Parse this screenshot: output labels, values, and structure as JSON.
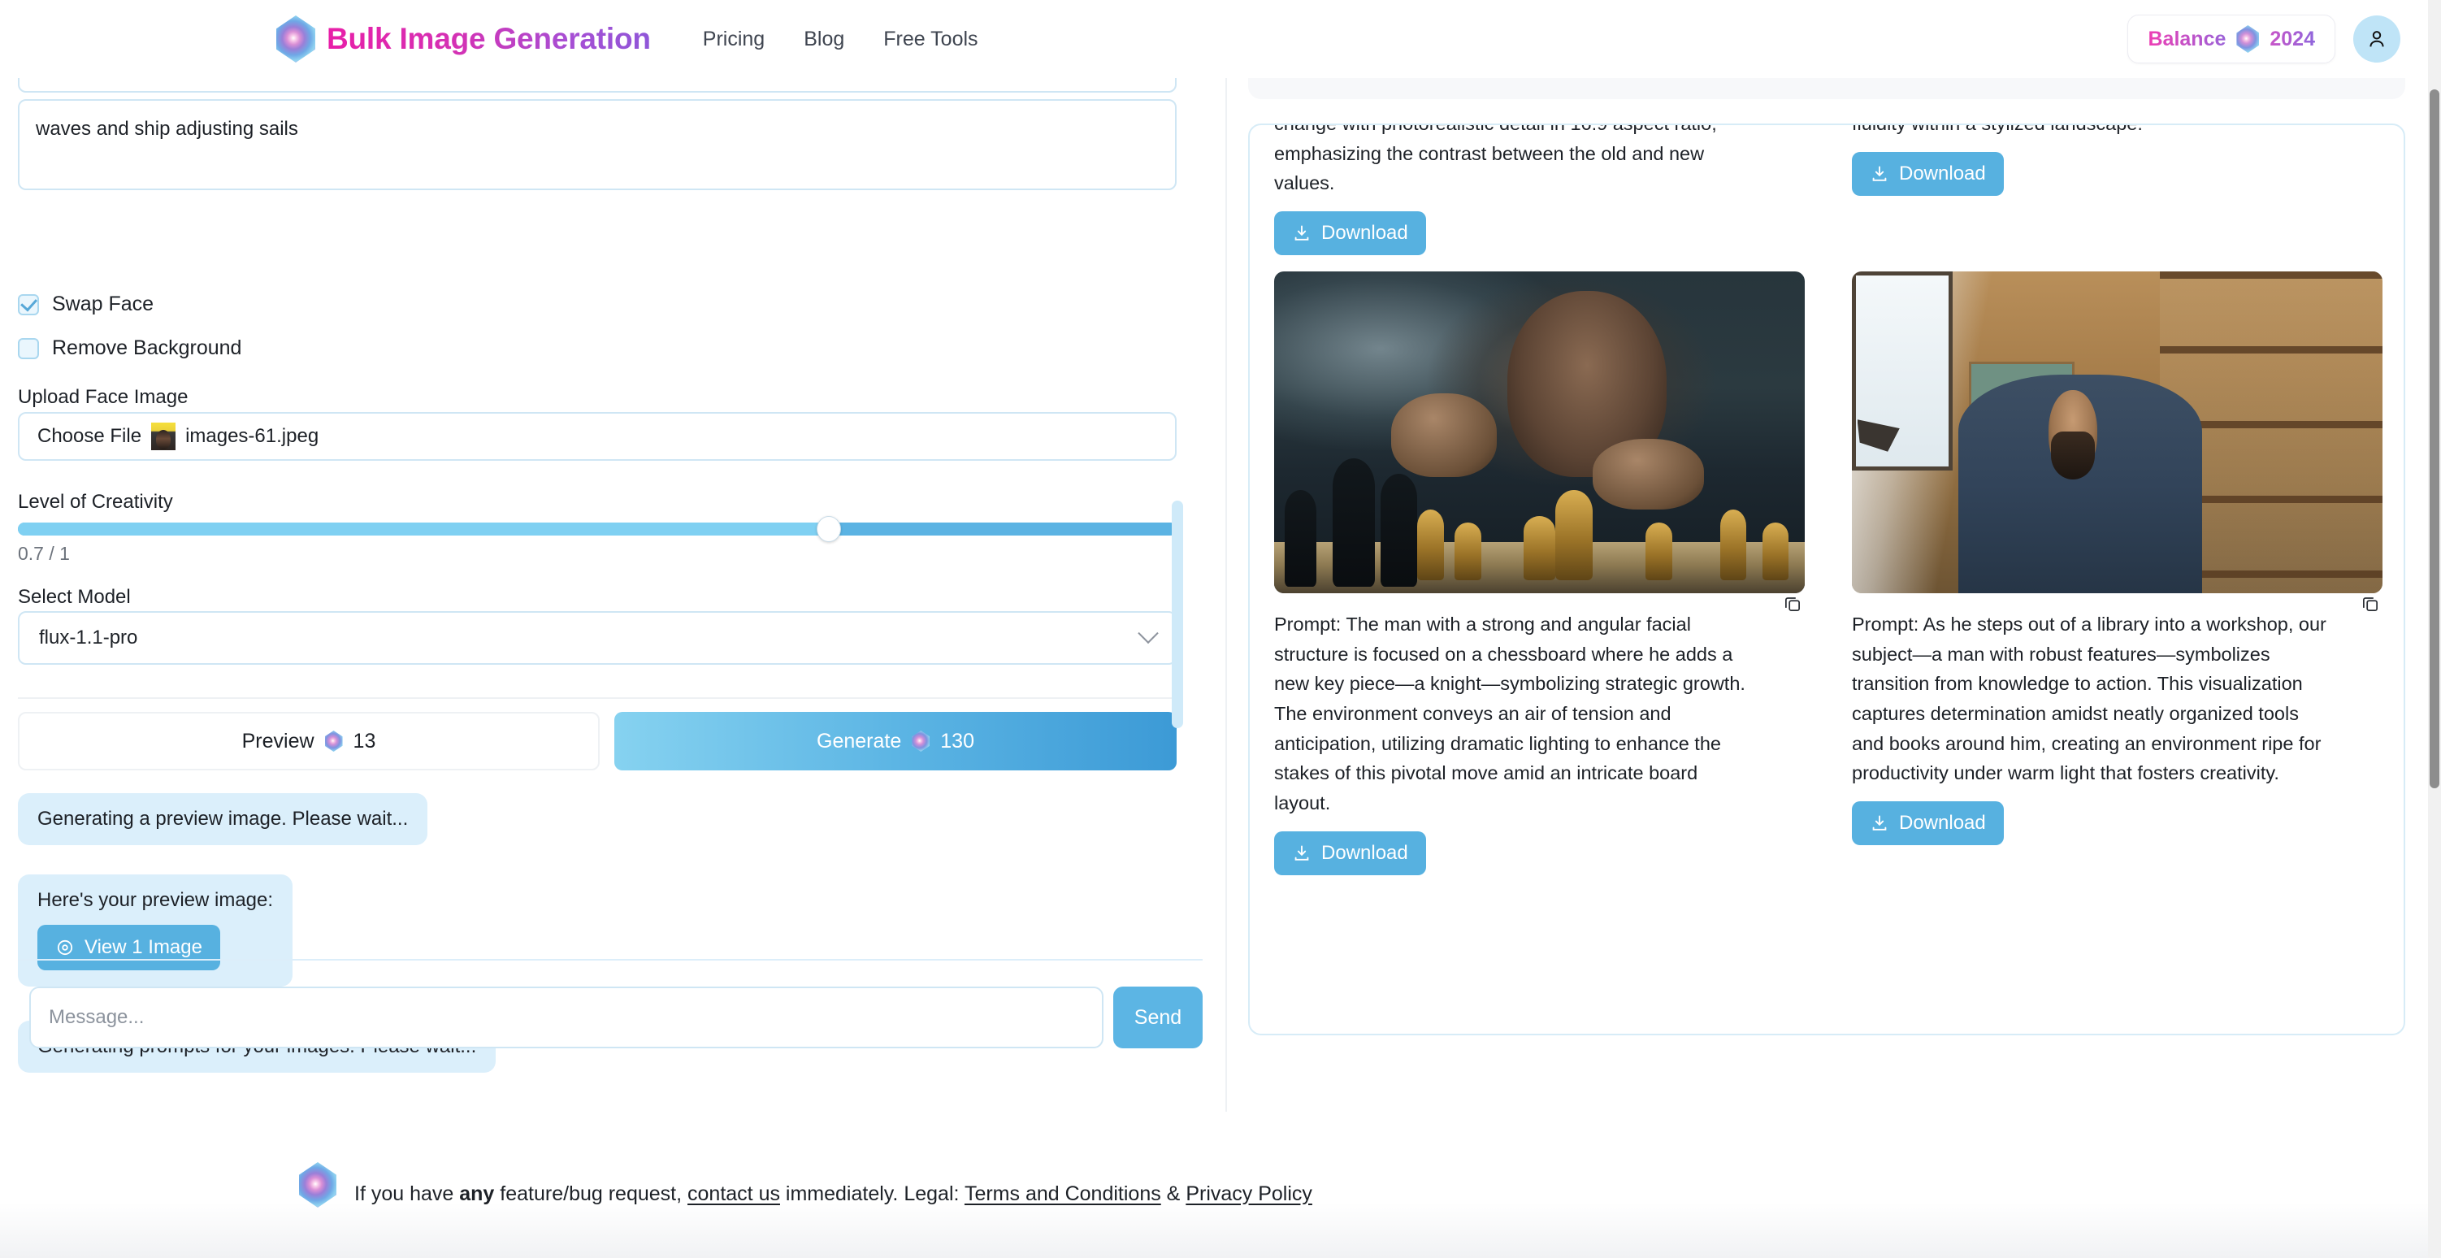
{
  "header": {
    "brand_title": "Bulk Image Generation",
    "logo_icon": "gem-logo-icon",
    "nav": [
      {
        "label": "Pricing"
      },
      {
        "label": "Blog"
      },
      {
        "label": "Free Tools"
      }
    ],
    "balance": {
      "label": "Balance",
      "amount": "2024",
      "coin_icon": "gem-coin-icon"
    },
    "account_icon": "user-avatar-icon"
  },
  "left_panel": {
    "prompt_textarea": {
      "value": "waves and ship adjusting sails"
    },
    "checkboxes": [
      {
        "label": "Swap Face",
        "checked": true
      },
      {
        "label": "Remove Background",
        "checked": false
      }
    ],
    "upload": {
      "label": "Upload Face Image",
      "button_label": "Choose File",
      "file_name": "images-61.jpeg"
    },
    "creativity": {
      "label": "Level of Creativity",
      "value_text": "0.7 / 1",
      "value": 0.7,
      "min": 0,
      "max": 1,
      "fill_color": "#7fd0f2",
      "track_color": "#5bb3e3"
    },
    "model": {
      "label": "Select Model",
      "selected": "flux-1.1-pro",
      "chevron_icon": "chevron-down-icon"
    },
    "actions": {
      "preview_label": "Preview",
      "preview_cost": "13",
      "generate_label": "Generate",
      "generate_cost": "130"
    },
    "chat": [
      {
        "text": "Generating a preview image. Please wait..."
      },
      {
        "text": "Here's your preview image:",
        "button_label": "View 1 Image",
        "button_icon": "eye-icon"
      },
      {
        "text": "Generating prompts for your images. Please wait..."
      }
    ],
    "composer": {
      "placeholder": "Message...",
      "send_label": "Send"
    }
  },
  "right_panel": {
    "copy_icon": "copy-icon",
    "download_icon": "download-icon",
    "download_label": "Download",
    "results": [
      {
        "id": "result-1",
        "prompt": "figure representing modern values. The atmosphere is symbolic and conceptual, highlighting the strength of transformation. The scene captures the moment of change with photorealistic detail in 16:9 aspect ratio, emphasizing the contrast between the old and new values.",
        "truncated_top": true,
        "has_image": false
      },
      {
        "id": "result-2",
        "prompt": "a ship adjusts its sails to follow the new tide. The mood conveys resilience and adaptability against nature's forces, set in vibrant colors that reflect movement and fluidity within a stylized landscape.",
        "truncated_top": true,
        "has_image": false
      },
      {
        "id": "result-3",
        "prompt": "Prompt: The man with a strong and angular facial structure is focused on a chessboard where he adds a new key piece—a knight—symbolizing strategic growth. The environment conveys an air of tension and anticipation, utilizing dramatic lighting to enhance the stakes of this pivotal move amid an intricate board layout.",
        "truncated_top": false,
        "has_image": true,
        "image_alt": "bearded man moving a golden knight on a chessboard in moody blue light"
      },
      {
        "id": "result-4",
        "prompt": "Prompt: As he steps out of a library into a workshop, our subject—a man with robust features—symbolizes transition from knowledge to action. This visualization captures determination amidst neatly organized tools and books around him, creating an environment ripe for productivity under warm light that fosters creativity.",
        "truncated_top": false,
        "has_image": true,
        "image_alt": "bearded man in a denim shirt standing in a warmly lit workshop with shelves of books and tools"
      }
    ]
  },
  "footer": {
    "logo_icon": "gem-logo-icon",
    "text_before": "If you have ",
    "bold_word": "any",
    "text_mid": " feature/bug request, ",
    "contact_link": "contact us",
    "text_after": " immediately. Legal: ",
    "terms_link": "Terms and Conditions",
    "amp": " & ",
    "privacy_link": "Privacy Policy"
  },
  "colors": {
    "accent_blue": "#57b1e0",
    "light_blue_bg": "#dbeffb",
    "border_blue": "#cfe6f4",
    "brand_pink": "#e81fa8",
    "brand_purple": "#8f56d8"
  }
}
